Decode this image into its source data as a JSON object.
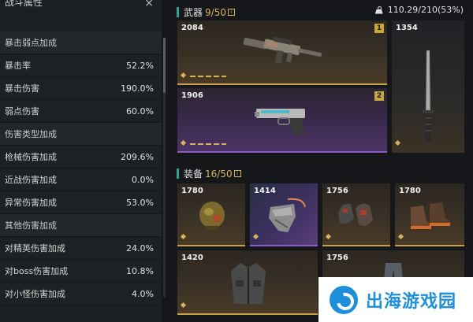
{
  "stats": {
    "title": "战斗属性",
    "close": "×",
    "rows": [
      {
        "type": "header",
        "label": "暴击弱点加成"
      },
      {
        "type": "stat",
        "label": "暴击率",
        "value": "52.2%"
      },
      {
        "type": "stat",
        "label": "暴击伤害",
        "value": "190.0%"
      },
      {
        "type": "stat",
        "label": "弱点伤害",
        "value": "60.0%"
      },
      {
        "type": "header",
        "label": "伤害类型加成"
      },
      {
        "type": "stat",
        "label": "枪械伤害加成",
        "value": "209.6%"
      },
      {
        "type": "stat",
        "label": "近战伤害加成",
        "value": "0.0%"
      },
      {
        "type": "stat",
        "label": "异常伤害加成",
        "value": "53.0%"
      },
      {
        "type": "header",
        "label": "其他伤害加成"
      },
      {
        "type": "stat",
        "label": "对精英伤害加成",
        "value": "24.0%"
      },
      {
        "type": "stat",
        "label": "对boss伤害加成",
        "value": "10.8%"
      },
      {
        "type": "stat",
        "label": "对小怪伤害加成",
        "value": "4.0%"
      }
    ]
  },
  "weapons": {
    "title": "武器",
    "count": "9/50",
    "icon": "info-box-icon",
    "items": [
      {
        "score": "2084",
        "slot": "1",
        "rarity": "gold",
        "icon": "assault-rifle-icon"
      },
      {
        "score": "1354",
        "rarity": "dark",
        "icon": "machete-icon"
      },
      {
        "score": "1906",
        "slot": "2",
        "rarity": "purple",
        "icon": "pistol-icon"
      }
    ]
  },
  "weight": {
    "value": "110.29/210(53%)",
    "icon": "weight-icon"
  },
  "gear": {
    "title": "装备",
    "count": "16/50",
    "icon": "info-box-icon",
    "items": [
      {
        "score": "1780",
        "rarity": "gold",
        "icon": "helmet-icon"
      },
      {
        "score": "1414",
        "rarity": "selected",
        "icon": "bandana-mask-icon"
      },
      {
        "score": "1756",
        "rarity": "gold",
        "icon": "gloves-icon"
      },
      {
        "score": "1780",
        "rarity": "gold",
        "icon": "boots-icon"
      },
      {
        "score": "1420",
        "rarity": "gold",
        "icon": "jacket-icon"
      },
      {
        "score": "1756",
        "rarity": "gold",
        "icon": "pants-icon"
      }
    ]
  },
  "watermark": {
    "text": "出海游戏园",
    "icon": "watermark-logo-icon"
  }
}
